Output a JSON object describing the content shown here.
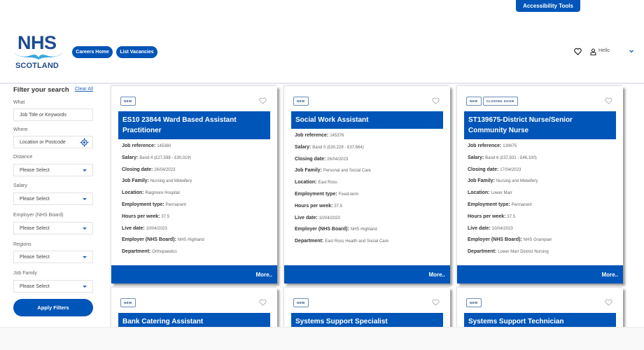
{
  "header": {
    "accessibility_label": "Accessibility Tools",
    "logo_top": "NHS",
    "logo_bottom": "SCOTLAND",
    "nav": [
      {
        "label": "Careers Home"
      },
      {
        "label": "List Vacancies"
      }
    ],
    "greeting": "Hello",
    "icons": {
      "favourites": "heart-icon",
      "user": "user-icon",
      "menu": "chevron-down-icon"
    }
  },
  "sidebar": {
    "title": "Filter your search",
    "clear_all": "Clear All",
    "filters": [
      {
        "label": "What",
        "placeholder": "Job Title or Keywords",
        "type": "text"
      },
      {
        "label": "Where",
        "placeholder": "Location or Postcode",
        "type": "location"
      },
      {
        "label": "Distance",
        "value": "Please Select",
        "type": "select"
      },
      {
        "label": "Salary",
        "value": "Please Select",
        "type": "select"
      },
      {
        "label": "Employer (NHS Board)",
        "value": "Please Select",
        "type": "select"
      },
      {
        "label": "Regions",
        "value": "Please Select",
        "type": "select"
      },
      {
        "label": "Job Family",
        "value": "Please Select",
        "type": "select"
      }
    ],
    "apply_label": "Apply Filters"
  },
  "field_labels": {
    "job_reference": "Job reference:",
    "salary": "Salary:",
    "closing_date": "Closing date:",
    "job_family": "Job Family:",
    "location": "Location:",
    "employment_type": "Employment type:",
    "hours_per_week": "Hours per week:",
    "live_date": "Live date:",
    "employer": "Employer (NHS Board):",
    "department": "Department:"
  },
  "more_label": "More..",
  "jobs": [
    {
      "tags": [
        "NEW"
      ],
      "title": "ES10 23844 Ward Based Assistant Practitioner",
      "job_reference": "145380",
      "salary": "Band 4 (£27,598 - £30,019)",
      "closing_date": "26/04/2023",
      "job_family": "Nursing and Midwifery",
      "location": "Raigmore Hospital",
      "employment_type": "Permanent",
      "hours_per_week": "37.5",
      "live_date": "10/04/2023",
      "employer": "NHS Highland",
      "department": "Orthopaedics"
    },
    {
      "tags": [
        "NEW"
      ],
      "title": "Social Work Assistant",
      "job_reference": "145376",
      "salary": "Band 5 (£30,229 - £37,664)",
      "closing_date": "26/04/2023",
      "job_family": "Personal and Social Care",
      "location": "East Ross",
      "employment_type": "Fixed-term",
      "hours_per_week": "37.5",
      "live_date": "10/04/2023",
      "employer": "NHS Highland",
      "department": "East Ross Health and Social Care"
    },
    {
      "tags": [
        "NEW",
        "CLOSING SOON"
      ],
      "title": "ST139675-District Nurse/Senior Community Nurse",
      "job_reference": "139675",
      "salary": "Band 6 (£37,831 - £46,100)",
      "closing_date": "17/04/2023",
      "job_family": "Nursing and Midwifery",
      "location": "Lower Marr",
      "employment_type": "Permanent",
      "hours_per_week": "37.5",
      "live_date": "10/04/2023",
      "employer": "NHS Grampian",
      "department": "Lower Marr District Nursing"
    },
    {
      "tags": [
        "NEW"
      ],
      "title": "Bank Catering Assistant"
    },
    {
      "tags": [
        "NEW"
      ],
      "title": "Systems Support Specialist"
    },
    {
      "tags": [
        "NEW"
      ],
      "title": "Systems Support Technician"
    }
  ]
}
